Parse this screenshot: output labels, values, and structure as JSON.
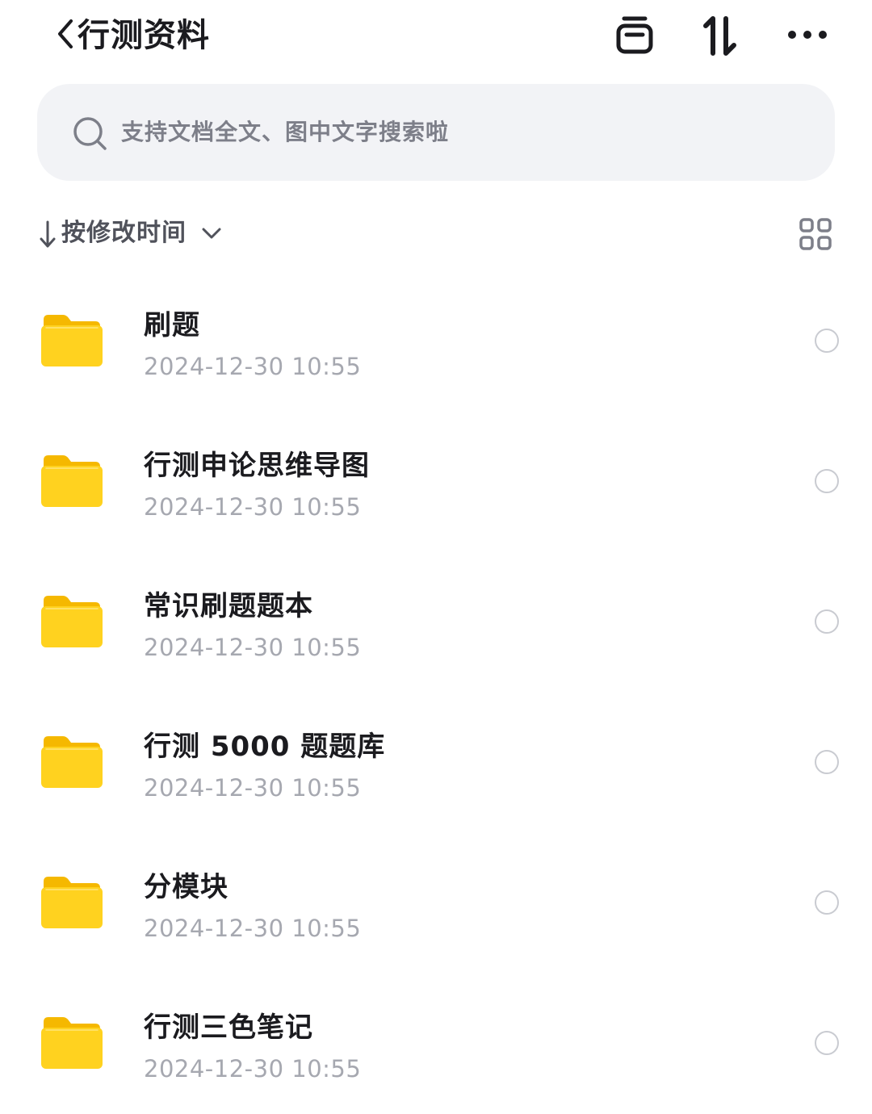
{
  "header": {
    "title": "行测资料",
    "icons": {
      "back": "chevron-left-icon",
      "archive": "archive-box-icon",
      "sort": "sort-arrows-icon",
      "more": "more-dots-icon"
    }
  },
  "search": {
    "placeholder": "支持文档全文、图中文字搜索啦",
    "icon": "search-icon"
  },
  "sort": {
    "label": "按修改时间",
    "direction_icon": "arrow-down-icon",
    "dropdown_icon": "chevron-down-icon",
    "view_toggle_icon": "grid-view-icon"
  },
  "files": [
    {
      "name": "刷题",
      "date": "2024-12-30 10:55",
      "type": "folder"
    },
    {
      "name": "行测申论思维导图",
      "date": "2024-12-30 10:55",
      "type": "folder"
    },
    {
      "name": "常识刷题题本",
      "date": "2024-12-30 10:55",
      "type": "folder"
    },
    {
      "name": "行测 5000 题题库",
      "date": "2024-12-30 10:55",
      "type": "folder"
    },
    {
      "name": "分模块",
      "date": "2024-12-30 10:55",
      "type": "folder"
    },
    {
      "name": "行测三色笔记",
      "date": "2024-12-30 10:55",
      "type": "folder"
    }
  ],
  "colors": {
    "folder_front": "#ffd21f",
    "folder_back": "#f5b800",
    "search_bg": "#f2f3f6",
    "secondary_text": "#a6a8b0",
    "radio_border": "#c9cbd1"
  }
}
